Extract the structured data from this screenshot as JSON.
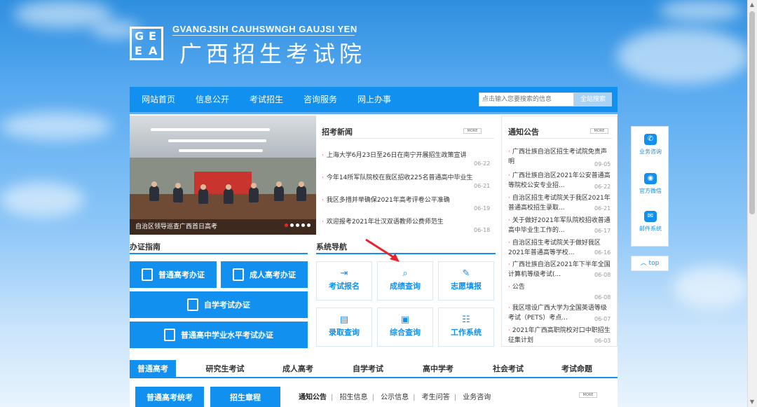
{
  "header": {
    "logo_text": "GEEA",
    "site_name_en": "GVANGJSIH CAUHSWNGH GAUJSI YEN",
    "site_name_cn": "广西招生考试院"
  },
  "nav": {
    "items": [
      "网站首页",
      "信息公开",
      "考试招生",
      "咨询服务",
      "网上办事"
    ],
    "search_placeholder": "点击输入您要搜索的信息",
    "search_button": "全站搜索"
  },
  "slider": {
    "caption": "自治区领导巡查广西首日高考"
  },
  "news": {
    "title": "招考新闻",
    "more": "MORE",
    "items": [
      {
        "text": "上海大学6月23日至26日在南宁开展招生政策宣讲",
        "date": "06-22"
      },
      {
        "text": "今年14所军队院校在我区招收225名普通高中毕业生",
        "date": "06-21"
      },
      {
        "text": "我区多措并举确保2021年高考评卷公平准确",
        "date": "06-19"
      },
      {
        "text": "欢迎报考2021年壮汉双语教师公费师范生",
        "date": "06-18"
      }
    ]
  },
  "notices": {
    "title": "通知公告",
    "more": "MORE",
    "items": [
      {
        "text": "广西壮族自治区招生考试院免责声明",
        "date": "09-05"
      },
      {
        "text": "广西壮族自治区2021年公安普通高等院校公安专业招...",
        "date": "06-22"
      },
      {
        "text": "自治区招生考试院关于我区2021年普通高校招生录取...",
        "date": "06-21"
      },
      {
        "text": "关于做好2021年军队院校招收普通高中毕业生工作的...",
        "date": "06-17"
      },
      {
        "text": "自治区招生考试院关于做好我区2021年普通高等学校...",
        "date": "06-16"
      },
      {
        "text": "广西壮族自治区2021年下半年全国计算机等级考试(...",
        "date": "06-08"
      },
      {
        "text": "公告",
        "date": "06-08"
      },
      {
        "text": "我区增设广西大学为全国英语等级考试（PETS）考点...",
        "date": "06-07"
      },
      {
        "text": "2021年广西高职院校对口中职招生征集计划",
        "date": "06-03"
      }
    ]
  },
  "guide": {
    "title": "办证指南",
    "buttons": [
      "普通高考办证",
      "成人高考办证",
      "自学考试办证",
      "普通高中学业水平考试办证"
    ]
  },
  "system_nav": {
    "title": "系统导航",
    "tiles": [
      {
        "label": "考试报名",
        "icon": "sign-in-icon"
      },
      {
        "label": "成绩查询",
        "icon": "search-icon"
      },
      {
        "label": "志愿填报",
        "icon": "pencil-icon"
      },
      {
        "label": "录取查询",
        "icon": "document-icon"
      },
      {
        "label": "综合查询",
        "icon": "clipboard-icon"
      },
      {
        "label": "工作系统",
        "icon": "table-icon"
      }
    ]
  },
  "side_float": {
    "items": [
      {
        "label": "业务咨询",
        "icon": "phone-icon"
      },
      {
        "label": "官方微信",
        "icon": "wechat-icon"
      },
      {
        "label": "邮件系统",
        "icon": "mail-icon"
      }
    ],
    "top": "top"
  },
  "tabs": {
    "items": [
      "普通高考",
      "研究生考试",
      "成人高考",
      "自学考试",
      "高中学考",
      "社会考试",
      "考试命题"
    ],
    "active": "普通高考"
  },
  "bottom": {
    "buttons": [
      "普通高考统考",
      "招生章程"
    ],
    "sub_tabs": [
      "通知公告",
      "招生信息",
      "公示信息",
      "考生问答",
      "业务咨询"
    ],
    "more": "MORE"
  },
  "colors": {
    "primary": "#1190f0",
    "accent_red": "#e02a2a"
  }
}
